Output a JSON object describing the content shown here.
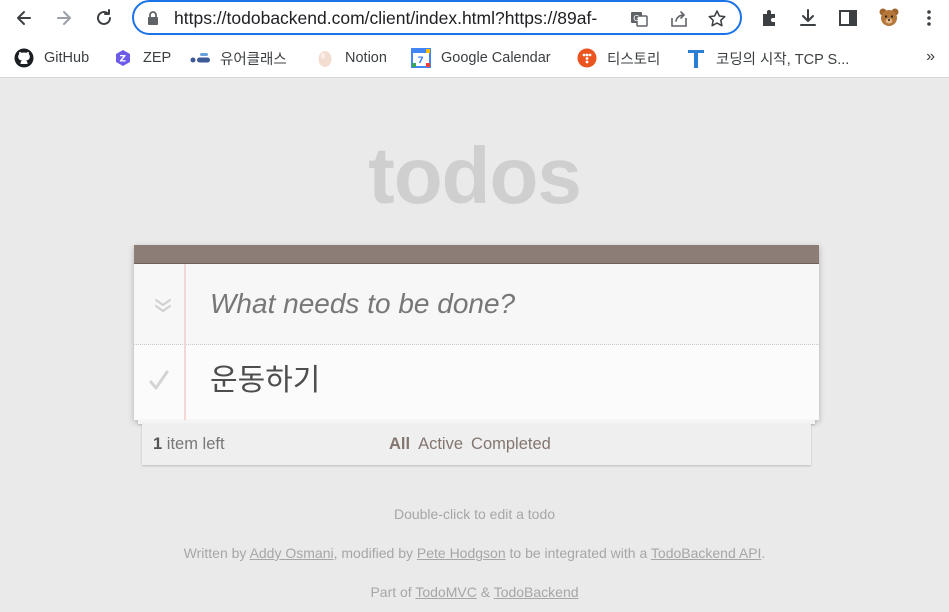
{
  "browser": {
    "url": "https://todobackend.com/client/index.html?https://89af-",
    "bookmarks": [
      {
        "label": "GitHub",
        "icon": "github-icon"
      },
      {
        "label": "ZEP",
        "icon": "zep-icon"
      },
      {
        "label": "유어클래스",
        "icon": "yourclass-icon"
      },
      {
        "label": "Notion",
        "icon": "notion-icon"
      },
      {
        "label": "Google Calendar",
        "icon": "calendar-icon"
      },
      {
        "label": "티스토리",
        "icon": "tistory-icon"
      },
      {
        "label": "코딩의 시작, TCP S...",
        "icon": "tcp-icon"
      }
    ],
    "more_label": "»",
    "colors": {
      "focus_ring": "#1a73e8"
    }
  },
  "app": {
    "title": "todos",
    "new_todo_placeholder": "What needs to be done?",
    "todos": [
      {
        "title": "운동하기",
        "completed": false
      }
    ],
    "footer": {
      "count": "1",
      "count_suffix": " item left",
      "filters": [
        "All",
        "Active",
        "Completed"
      ],
      "selected_filter": "All"
    },
    "info": {
      "edit_hint": "Double-click to edit a todo",
      "written_by": "Written by ",
      "author1": "Addy Osmani",
      "modified_by": ", modified by ",
      "author2": "Pete Hodgson",
      "integrated": " to be integrated with a ",
      "api_link": "TodoBackend API",
      "period": ".",
      "part_of": "Part of ",
      "todomvc": "TodoMVC",
      "amp": " & ",
      "todobackend": "TodoBackend"
    },
    "colors": {
      "header_bar": "#8d7d77",
      "title": "#cfcfcf",
      "filter_text": "#83756f"
    }
  }
}
